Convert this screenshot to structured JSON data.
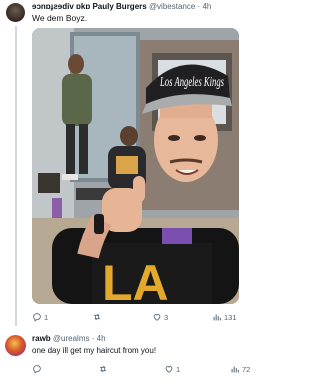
{
  "tweet": {
    "display_name": "ɘɔnɒɟƨɘdiv ɒkɒ Pauly Burgers",
    "handle": "@vibestance",
    "time": "4h",
    "text": "We dem Boyz.",
    "media": {
      "cap_text": "Los Angeles Kings",
      "shirt_text": "LA"
    },
    "stats": {
      "replies": "1",
      "reposts": "",
      "likes": "3",
      "views": "131"
    }
  },
  "reply": {
    "display_name": "rawb",
    "handle": "@urealms",
    "time": "4h",
    "text": "one day ill get my haircut from you!",
    "stats": {
      "replies": "",
      "reposts": "",
      "likes": "1",
      "views": "72"
    }
  },
  "colors": {
    "text": "#0f1419",
    "muted": "#536471",
    "thread_line": "#cfd9de",
    "background": "#ffffff"
  }
}
